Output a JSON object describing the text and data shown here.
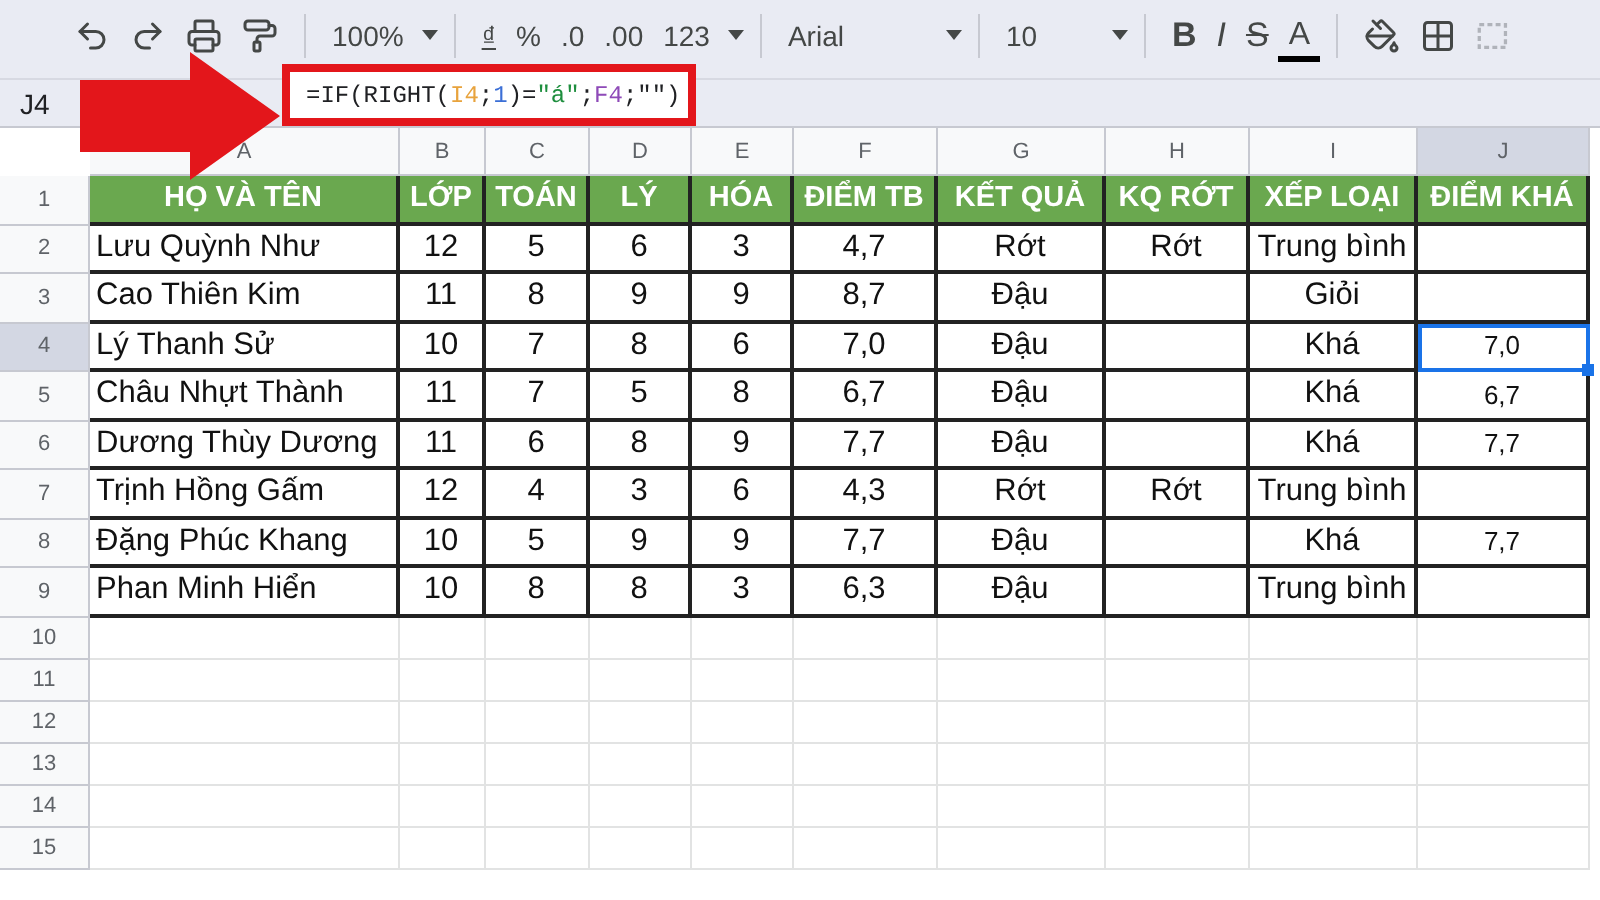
{
  "toolbar": {
    "zoom": "100%",
    "currency": "₫",
    "percent": "%",
    "decrease_decimals": ".0",
    "increase_decimals": ".00",
    "number_format": "123",
    "font": "Arial",
    "font_size": "10",
    "bold": "B",
    "italic": "I",
    "strikethrough": "S",
    "text_color": "A"
  },
  "formula_bar": {
    "cell_ref": "J4",
    "formula": [
      {
        "text": "=IF(RIGHT(",
        "color": "#202124"
      },
      {
        "text": "I4",
        "color": "#e8a33d"
      },
      {
        "text": ";",
        "color": "#202124"
      },
      {
        "text": "1",
        "color": "#3b6fd6"
      },
      {
        "text": ")=",
        "color": "#202124"
      },
      {
        "text": "\"á\"",
        "color": "#1e8e3e"
      },
      {
        "text": ";",
        "color": "#202124"
      },
      {
        "text": "F4",
        "color": "#8e4ab8"
      },
      {
        "text": ";\"\")",
        "color": "#202124"
      }
    ]
  },
  "columns": [
    {
      "label": "A",
      "selected": false
    },
    {
      "label": "B",
      "selected": false
    },
    {
      "label": "C",
      "selected": false
    },
    {
      "label": "D",
      "selected": false
    },
    {
      "label": "E",
      "selected": false
    },
    {
      "label": "F",
      "selected": false
    },
    {
      "label": "G",
      "selected": false
    },
    {
      "label": "H",
      "selected": false
    },
    {
      "label": "I",
      "selected": false
    },
    {
      "label": "J",
      "selected": true
    }
  ],
  "rows": [
    {
      "number": "1",
      "kind": "header",
      "selected": false,
      "cells": [
        "HỌ VÀ TÊN",
        "LỚP",
        "TOÁN",
        "LÝ",
        "HÓA",
        "ĐIỂM TB",
        "KẾT QUẢ",
        "KQ RỚT",
        "XẾP LOẠI",
        "ĐIỂM KHÁ"
      ]
    },
    {
      "number": "2",
      "kind": "data",
      "selected": false,
      "cells": [
        "Lưu Quỳnh Như",
        "12",
        "5",
        "6",
        "3",
        "4,7",
        "Rớt",
        "Rớt",
        "Trung bình",
        ""
      ]
    },
    {
      "number": "3",
      "kind": "data",
      "selected": false,
      "cells": [
        "Cao Thiên Kim",
        "11",
        "8",
        "9",
        "9",
        "8,7",
        "Đậu",
        "",
        "Giỏi",
        ""
      ]
    },
    {
      "number": "4",
      "kind": "data",
      "selected": true,
      "cells": [
        "Lý Thanh Sử",
        "10",
        "7",
        "8",
        "6",
        "7,0",
        "Đậu",
        "",
        "Khá",
        "7,0"
      ]
    },
    {
      "number": "5",
      "kind": "data",
      "selected": false,
      "cells": [
        "Châu Nhựt Thành",
        "11",
        "7",
        "5",
        "8",
        "6,7",
        "Đậu",
        "",
        "Khá",
        "6,7"
      ]
    },
    {
      "number": "6",
      "kind": "data",
      "selected": false,
      "cells": [
        "Dương Thùy Dương",
        "11",
        "6",
        "8",
        "9",
        "7,7",
        "Đậu",
        "",
        "Khá",
        "7,7"
      ]
    },
    {
      "number": "7",
      "kind": "data",
      "selected": false,
      "cells": [
        "Trịnh Hồng Gấm",
        "12",
        "4",
        "3",
        "6",
        "4,3",
        "Rớt",
        "Rớt",
        "Trung bình",
        ""
      ]
    },
    {
      "number": "8",
      "kind": "data",
      "selected": false,
      "cells": [
        "Đặng Phúc Khang",
        "10",
        "5",
        "9",
        "9",
        "7,7",
        "Đậu",
        "",
        "Khá",
        "7,7"
      ]
    },
    {
      "number": "9",
      "kind": "data",
      "selected": false,
      "cells": [
        "Phan Minh Hiển",
        "10",
        "8",
        "8",
        "3",
        "6,3",
        "Đậu",
        "",
        "Trung bình",
        ""
      ]
    }
  ],
  "empty_rows": [
    "10",
    "11",
    "12",
    "13",
    "14",
    "15"
  ]
}
